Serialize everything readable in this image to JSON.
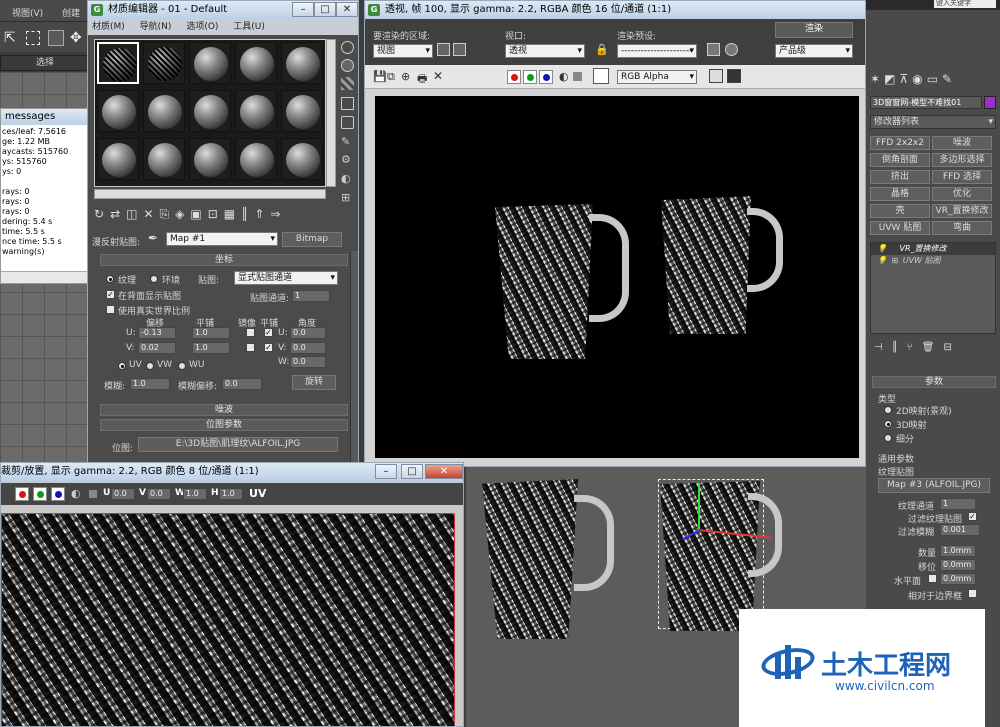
{
  "bg_window": {
    "menu_items": [
      "视图(V)",
      "创建"
    ],
    "select_label": "选择",
    "messages_title": "messages",
    "messages_lines": [
      "ces/leaf: 7.5616",
      "ge: 1.22 MB",
      "aycasts: 515760",
      "ys: 515760",
      "ys: 0",
      "",
      "rays: 0",
      "rays: 0",
      "rays: 0",
      "dering: 5.4 s",
      "time: 5.5 s",
      "nce time: 5.5 s",
      "warning(s)"
    ]
  },
  "material_editor": {
    "title": "材质编辑器 - 01 - Default",
    "menu": [
      "材质(M)",
      "导航(N)",
      "选项(O)",
      "工具(U)"
    ],
    "map_label": "漫反射贴图:",
    "map_name": "Map #1",
    "map_type": "Bitmap",
    "rollout_coords": "坐标",
    "radio_texture": "纹理",
    "radio_env": "环境",
    "mapping_label": "贴图:",
    "mapping_value": "显式贴图通道",
    "chk_show_back": "在背面显示贴图",
    "channel_label": "贴图通道:",
    "channel_value": "1",
    "chk_real_world": "使用真实世界比例",
    "col_offset": "偏移",
    "col_tiling": "平铺",
    "col_mirror": "镜像",
    "col_tile": "平铺",
    "col_angle": "角度",
    "u_label": "U:",
    "v_label": "V:",
    "w_label": "W:",
    "u_offset": "-0.13",
    "u_tiling": "1.0",
    "u_angle": "0.0",
    "v_offset": "0.02",
    "v_tiling": "1.0",
    "v_angle": "0.0",
    "w_angle": "0.0",
    "radio_uv": "UV",
    "radio_vw": "VW",
    "radio_wu": "WU",
    "blur_label": "模糊:",
    "blur_value": "1.0",
    "blur_offset_label": "模糊偏移:",
    "blur_offset_value": "0.0",
    "rotate_btn": "旋转",
    "rollout_noise": "噪波",
    "rollout_bitmap": "位图参数",
    "bitmap_label": "位图:",
    "bitmap_path": "E:\\3D贴图\\肌理纹\\ALFOIL.JPG"
  },
  "render_window": {
    "title": "透视, 帧 100, 显示 gamma: 2.2, RGBA 颜色 16 位/通道 (1:1)",
    "area_label": "要渲染的区域:",
    "area_value": "视图",
    "viewport_label": "视口:",
    "viewport_value": "透视",
    "preset_label": "渲染预设:",
    "preset_value": "----------------------",
    "render_btn": "渲染",
    "quality_value": "产品级",
    "channel_value": "RGB Alpha"
  },
  "bitmap_window": {
    "title": "裁剪/放置, 显示 gamma: 2.2, RGB 颜色 8 位/通道 (1:1)",
    "u_label": "U",
    "u_value": "0.0",
    "v_label": "V",
    "v_value": "0.0",
    "w_label": "W",
    "w_value": "1.0",
    "h_label": "H",
    "h_value": "1.0",
    "uv_label": "UV"
  },
  "command_panel": {
    "object_name": "3D窗窗网-模型不难找01",
    "modifier_list": "修改器列表",
    "buttons": [
      "FFD 2x2x2",
      "噪波",
      "倒角剖面",
      "多边形选择",
      "挤出",
      "FFD 选择",
      "晶格",
      "优化",
      "壳",
      "VR_置换修改",
      "UVW 贴图",
      "弯曲"
    ],
    "stack": [
      "VR_置换修改",
      "UVW 贴图"
    ],
    "params_title": "参数",
    "type_label": "类型",
    "type_opts": [
      "2D映射(景观)",
      "3D映射",
      "细分"
    ],
    "common_label": "通用参数",
    "tex_map_label": "纹理贴图",
    "tex_map_value": "Map #3 (ALFOIL.JPG)",
    "tex_channel_label": "纹理通道",
    "tex_channel_value": "1",
    "filter_label": "过滤纹理贴图",
    "filter_blur_label": "过滤模糊",
    "filter_blur_value": "0.001",
    "amount_label": "数量",
    "amount_value": "1.0mm",
    "shift_label": "移位",
    "shift_value": "0.0mm",
    "water_label": "水平面",
    "water_value": "0.0mm",
    "border_label": "相对于边界框"
  },
  "top_strip": {
    "text": "键入关键字"
  },
  "watermark": {
    "name": "土木工程网",
    "url": "www.civilcn.com"
  }
}
